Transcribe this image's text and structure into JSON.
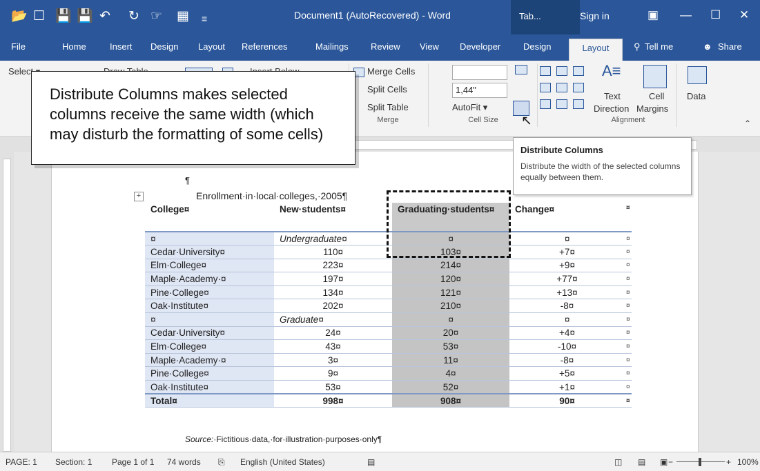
{
  "title_bar": {
    "doc_title": "Document1 (AutoRecovered)  -  Word",
    "table_tools": "Tab...",
    "sign_in": "Sign in"
  },
  "ribbon_tabs": {
    "file": "File",
    "home": "Home",
    "insert": "Insert",
    "design": "Design",
    "layout": "Layout",
    "references": "References",
    "mailings": "Mailings",
    "review": "Review",
    "view": "View",
    "developer": "Developer",
    "design_table": "Design",
    "layout_table": "Layout",
    "tell_me": "Tell me",
    "share": "Share"
  },
  "ribbon": {
    "select": "Select ▾",
    "draw_table": "Draw Table",
    "insert_below": "Insert Below",
    "merge_cells": "Merge Cells",
    "split_cells": "Split Cells",
    "split_table": "Split Table",
    "merge_group": "Merge",
    "cell_width": "1,44\"",
    "autofit": "AutoFit ▾",
    "cell_size_group": "Cell Size",
    "text_direction_1": "Text",
    "text_direction_2": "Direction",
    "cell_margins_1": "Cell",
    "cell_margins_2": "Margins",
    "alignment_group": "Alignment",
    "data": "Data"
  },
  "callout": {
    "text": "Distribute Columns makes selected columns receive the same width (which may disturb the formatting of some cells)"
  },
  "tooltip": {
    "title": "Distribute Columns",
    "description": "Distribute the width of the selected columns equally between them."
  },
  "document": {
    "para_mark": "¶",
    "caption": "Enrollment·in·local·colleges,·2005¶",
    "source_label": "Source:",
    "source_text": "·Fictitious·data,·for·illustration·purposes·only¶",
    "table": {
      "headers": [
        "College¤",
        "New·students¤",
        "Graduating·students¤",
        "Change¤"
      ],
      "rows": [
        [
          "¤",
          "Undergraduate¤",
          "¤",
          "¤"
        ],
        [
          "Cedar·University¤",
          "110¤",
          "103¤",
          "+7¤"
        ],
        [
          "Elm·College¤",
          "223¤",
          "214¤",
          "+9¤"
        ],
        [
          "Maple·Academy·¤",
          "197¤",
          "120¤",
          "+77¤"
        ],
        [
          "Pine·College¤",
          "134¤",
          "121¤",
          "+13¤"
        ],
        [
          "Oak·Institute¤",
          "202¤",
          "210¤",
          "-8¤"
        ],
        [
          "¤",
          "Graduate¤",
          "¤",
          "¤"
        ],
        [
          "Cedar·University¤",
          "24¤",
          "20¤",
          "+4¤"
        ],
        [
          "Elm·College¤",
          "43¤",
          "53¤",
          "-10¤"
        ],
        [
          "Maple·Academy·¤",
          "3¤",
          "11¤",
          "-8¤"
        ],
        [
          "Pine·College¤",
          "9¤",
          "4¤",
          "+5¤"
        ],
        [
          "Oak·Institute¤",
          "53¤",
          "52¤",
          "+1¤"
        ],
        [
          "Total¤",
          "998¤",
          "908¤",
          "90¤"
        ]
      ],
      "row_end": "¤"
    }
  },
  "status_bar": {
    "page": "PAGE: 1",
    "section": "Section: 1",
    "page_of": "Page 1 of 1",
    "words": "74 words",
    "language": "English (United States)",
    "zoom": "100%"
  },
  "colors": {
    "word_blue": "#2b579a",
    "selection_gray": "#c4c4c4",
    "first_col_tint": "#dfe6f4"
  }
}
